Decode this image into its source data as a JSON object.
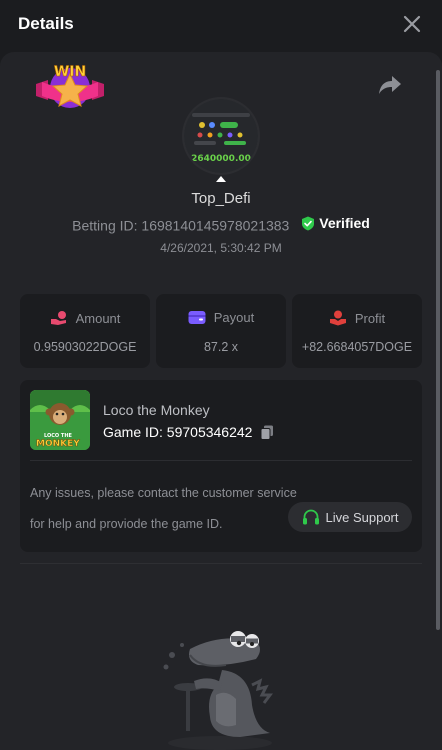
{
  "header": {
    "title": "Details"
  },
  "badge": {
    "label": "WIN"
  },
  "user": {
    "name": "Top_Defi",
    "avatar_amount": "2640000.00"
  },
  "bet": {
    "id_label": "Betting ID: 1698140145978021383",
    "verified_label": "Verified",
    "datetime": "4/26/2021, 5:30:42 PM"
  },
  "stats": [
    {
      "label": "Amount",
      "value": "0.95903022DOGE",
      "icon": "money-hand-icon",
      "color": "#e84a6f"
    },
    {
      "label": "Payout",
      "value": "87.2 x",
      "icon": "wallet-icon",
      "color": "#7a5cff"
    },
    {
      "label": "Profit",
      "value": "+82.6684057DOGE",
      "icon": "profit-hand-icon",
      "color": "#e0403c"
    }
  ],
  "game": {
    "thumb_caption_top": "LOCO THE",
    "thumb_caption_bottom": "MONKEY",
    "name": "Loco the Monkey",
    "id_label": "Game ID: 59705346242"
  },
  "support": {
    "text": "Any issues, please contact the customer service for help and proviode the game ID.",
    "button_label": "Live Support"
  },
  "colors": {
    "accent_green": "#2fc94b",
    "verified": "#2fc94b",
    "background": "#1b1c1f",
    "panel": "#232428"
  }
}
